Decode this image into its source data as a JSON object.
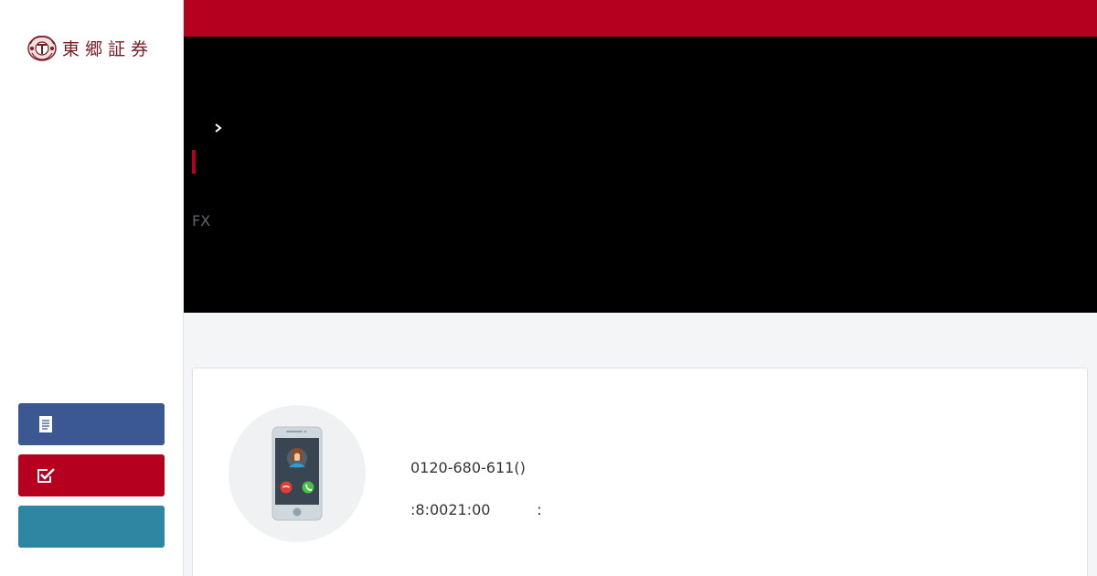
{
  "brand": {
    "name": "東郷証券"
  },
  "sidebar": {
    "buttons": [
      {
        "icon": "document-icon",
        "label": ""
      },
      {
        "icon": "checkbox-icon",
        "label": ""
      },
      {
        "icon": "",
        "label": ""
      }
    ]
  },
  "hero": {
    "fx_label": "FX"
  },
  "contact": {
    "phone": "0120-680-611()",
    "hours": ":8:0021:00          :"
  },
  "colors": {
    "brand_red": "#b50020",
    "docs_blue": "#3b5892",
    "teal": "#2e86a3",
    "hero_bg": "#000000",
    "logo_text": "#7a1b24"
  }
}
